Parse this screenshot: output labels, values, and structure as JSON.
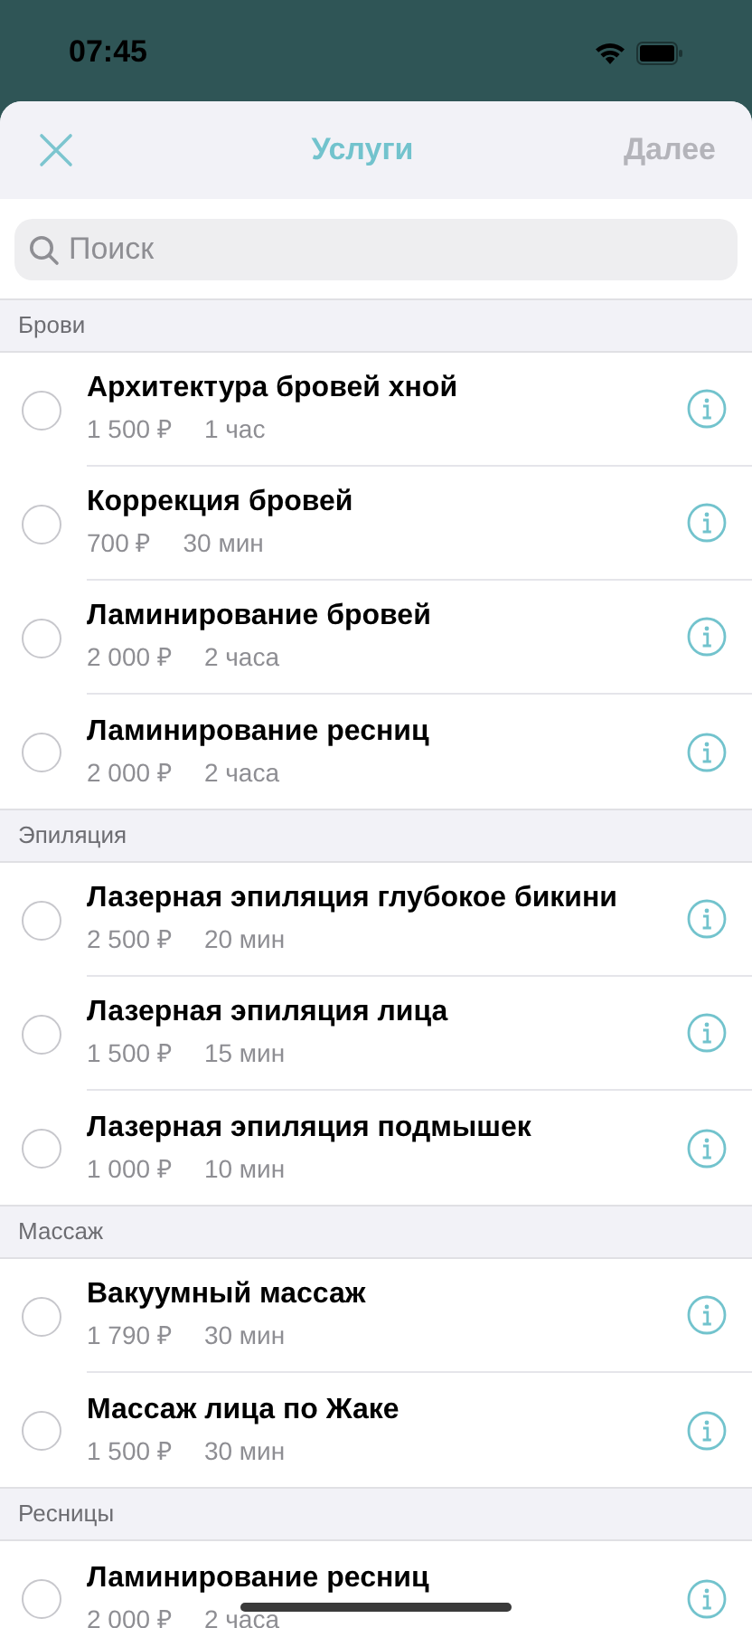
{
  "status_bar": {
    "time": "07:45"
  },
  "nav": {
    "title": "Услуги",
    "next": "Далее",
    "next_disabled": true
  },
  "search": {
    "placeholder": "Поиск"
  },
  "sections": [
    {
      "title": "Брови",
      "items": [
        {
          "name": "Архитектура бровей хной",
          "price": "1 500 ₽",
          "duration": "1 час",
          "selected": false
        },
        {
          "name": "Коррекция бровей",
          "price": "700 ₽",
          "duration": "30 мин",
          "selected": false
        },
        {
          "name": "Ламинирование бровей",
          "price": "2 000 ₽",
          "duration": "2 часа",
          "selected": false
        },
        {
          "name": "Ламинирование ресниц",
          "price": "2 000 ₽",
          "duration": "2 часа",
          "selected": false
        }
      ]
    },
    {
      "title": "Эпиляция",
      "items": [
        {
          "name": "Лазерная эпиляция глубокое бикини",
          "price": "2 500 ₽",
          "duration": "20 мин",
          "selected": false
        },
        {
          "name": "Лазерная эпиляция лица",
          "price": "1 500 ₽",
          "duration": "15 мин",
          "selected": false
        },
        {
          "name": "Лазерная эпиляция подмышек",
          "price": "1 000 ₽",
          "duration": "10 мин",
          "selected": false
        }
      ]
    },
    {
      "title": "Массаж",
      "items": [
        {
          "name": "Вакуумный массаж",
          "price": "1 790 ₽",
          "duration": "30 мин",
          "selected": false
        },
        {
          "name": "Массаж лица по Жаке",
          "price": "1 500 ₽",
          "duration": "30 мин",
          "selected": false
        }
      ]
    },
    {
      "title": "Ресницы",
      "items": [
        {
          "name": "Ламинирование ресниц",
          "price": "2 000 ₽",
          "duration": "2 часа",
          "selected": false
        }
      ]
    }
  ]
}
